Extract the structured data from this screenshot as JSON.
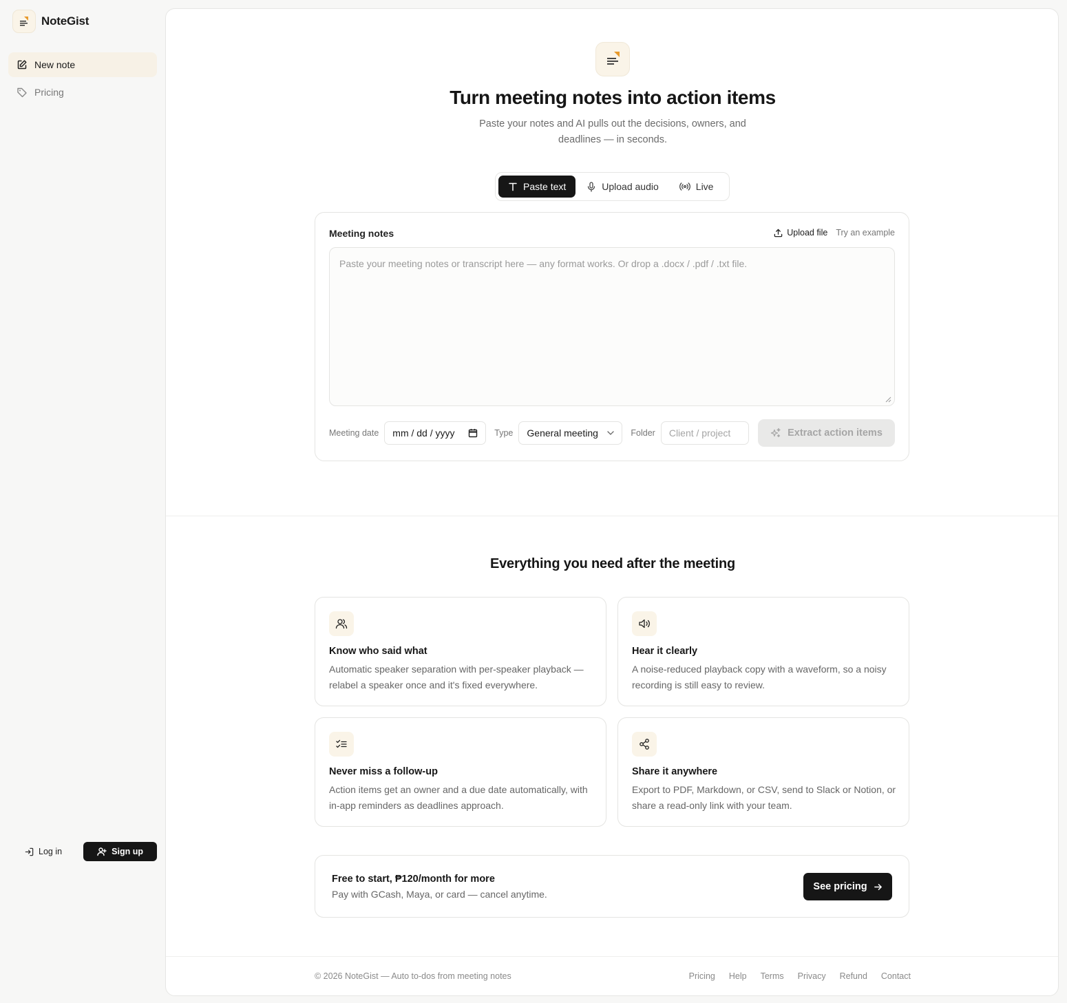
{
  "brand": {
    "name": "NoteGist"
  },
  "sidebar": {
    "items": [
      {
        "label": "New note",
        "icon": "edit-icon",
        "active": true
      },
      {
        "label": "Pricing",
        "icon": "tag-icon",
        "active": false
      }
    ],
    "login_label": "Log in",
    "signup_label": "Sign up"
  },
  "hero": {
    "title": "Turn meeting notes into action items",
    "subtitle": "Paste your notes and AI pulls out the decisions, owners, and deadlines — in seconds."
  },
  "modes": [
    {
      "label": "Paste text",
      "icon": "text-icon",
      "active": true
    },
    {
      "label": "Upload audio",
      "icon": "microphone-icon",
      "active": false
    },
    {
      "label": "Live",
      "icon": "broadcast-icon",
      "active": false
    }
  ],
  "notes": {
    "label": "Meeting notes",
    "upload_file": "Upload file",
    "try_example": "Try an example",
    "placeholder": "Paste your meeting notes or transcript here — any format works. Or drop a .docx / .pdf / .txt file."
  },
  "controls": {
    "date_label": "Meeting date",
    "date_placeholder": "mm / dd / yyyy",
    "type_label": "Type",
    "type_value": "General meeting",
    "folder_label": "Folder",
    "folder_placeholder": "Client / project",
    "extract_label": "Extract action items"
  },
  "features": {
    "title": "Everything you need after the meeting",
    "items": [
      {
        "icon": "users-icon",
        "title": "Know who said what",
        "desc": "Automatic speaker separation with per-speaker playback — relabel a speaker once and it's fixed everywhere."
      },
      {
        "icon": "speaker-icon",
        "title": "Hear it clearly",
        "desc": "A noise-reduced playback copy with a waveform, so a noisy recording is still easy to review."
      },
      {
        "icon": "checklist-icon",
        "title": "Never miss a follow-up",
        "desc": "Action items get an owner and a due date automatically, with in-app reminders as deadlines approach."
      },
      {
        "icon": "share-icon",
        "title": "Share it anywhere",
        "desc": "Export to PDF, Markdown, or CSV, send to Slack or Notion, or share a read-only link with your team."
      }
    ]
  },
  "pricing": {
    "title": "Free to start, ₱120/month for more",
    "subtitle": "Pay with GCash, Maya, or card — cancel anytime.",
    "button": "See pricing"
  },
  "footer": {
    "copyright": "© 2026 NoteGist — Auto to-dos from meeting notes",
    "links": [
      "Pricing",
      "Help",
      "Terms",
      "Privacy",
      "Refund",
      "Contact"
    ]
  },
  "colors": {
    "accent": "#e89a2c",
    "dark": "#161616",
    "icon_bg": "#faf4e8"
  }
}
